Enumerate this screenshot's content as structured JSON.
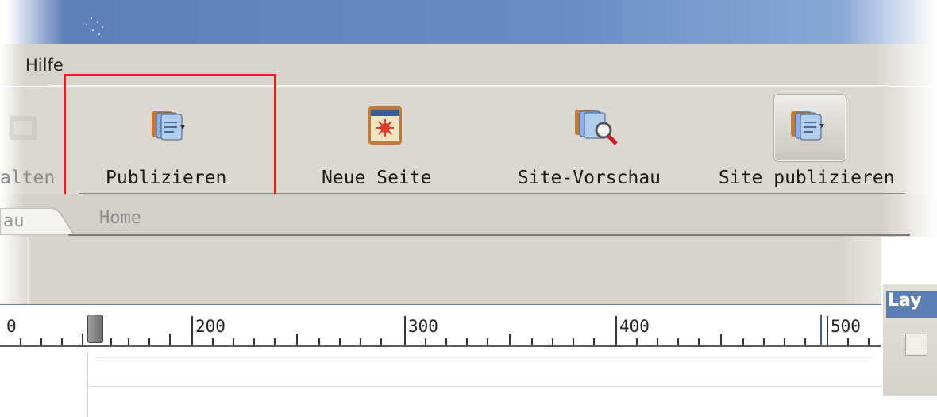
{
  "menu": {
    "items": [
      "Hilfe"
    ]
  },
  "toolbar": {
    "partial_label": "alten",
    "buttons": [
      {
        "label": "Publizieren",
        "icon": "publish-icon"
      },
      {
        "label": "Neue Seite",
        "icon": "new-page-icon"
      },
      {
        "label": "Site-Vorschau",
        "icon": "site-preview-icon"
      },
      {
        "label": "Site publizieren",
        "icon": "site-publish-icon",
        "pressed": true
      }
    ]
  },
  "tabs": [
    {
      "label": "au",
      "active": true
    },
    {
      "label": "Home",
      "active": false
    }
  ],
  "ruler": {
    "start_partial": "0",
    "labels": [
      "200",
      "300",
      "400",
      "500"
    ]
  },
  "layer_panel": {
    "title": "Lay"
  },
  "colors": {
    "highlight": "#ec1c1c",
    "titlebar": "#5d80b8",
    "toolbar_bg": "#dcd8d0"
  }
}
